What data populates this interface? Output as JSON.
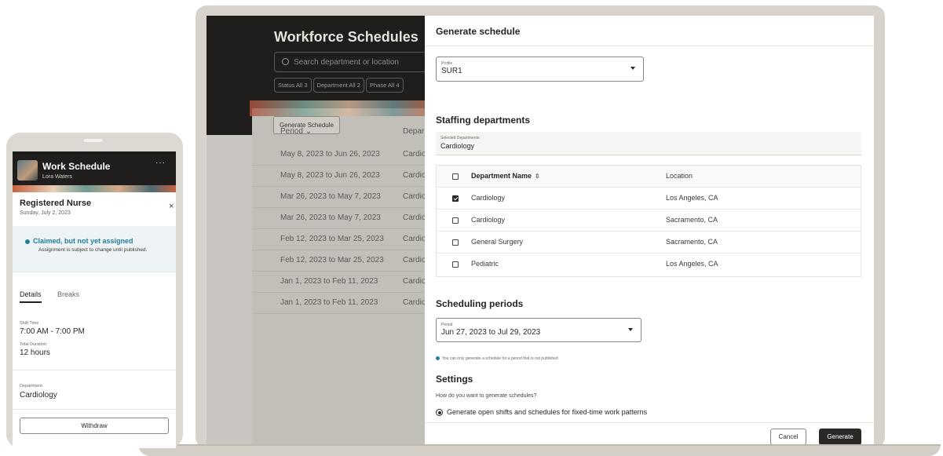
{
  "laptop": {
    "background_app": {
      "title": "Workforce Schedules",
      "search_placeholder": "Search department or location",
      "filters": [
        "Status All 3",
        "Department All 2",
        "Phase All 4"
      ],
      "generate_button": "Generate Schedule",
      "columns": [
        "Period",
        "Depar"
      ],
      "rows": [
        {
          "period": "May 8, 2023 to Jun 26, 2023",
          "dept": "Cardio"
        },
        {
          "period": "May 8, 2023 to Jun 26, 2023",
          "dept": "Cardio"
        },
        {
          "period": "Mar 26, 2023 to May 7, 2023",
          "dept": "Cardio"
        },
        {
          "period": "Mar 26, 2023 to May 7, 2023",
          "dept": "Cardio"
        },
        {
          "period": "Feb 12, 2023 to Mar 25, 2023",
          "dept": "Cardio"
        },
        {
          "period": "Feb 12, 2023 to Mar 25, 2023",
          "dept": "Cardio"
        },
        {
          "period": "Jan 1, 2023 to Feb 11, 2023",
          "dept": "Cardio"
        },
        {
          "period": "Jan 1, 2023 to Feb 11, 2023",
          "dept": "Cardio"
        }
      ]
    },
    "drawer": {
      "title": "Generate schedule",
      "profile": {
        "label": "Profile",
        "value": "SUR1"
      },
      "staffing": {
        "title": "Staffing departments",
        "selected_label": "Selected Departments",
        "selected_value": "Cardiology",
        "headers": {
          "name": "Department Name",
          "sort_icon": "sort-icon",
          "location": "Location"
        },
        "rows": [
          {
            "name": "Cardiology",
            "location": "Los Angeles, CA",
            "checked": true
          },
          {
            "name": "Cardiology",
            "location": "Sacramento, CA",
            "checked": false
          },
          {
            "name": "General Surgery",
            "location": "Sacramento, CA",
            "checked": false
          },
          {
            "name": "Pediatric",
            "location": "Los Angeles, CA",
            "checked": false
          }
        ]
      },
      "periods": {
        "title": "Scheduling periods",
        "label": "Period",
        "value": "Jun 27, 2023 to Jul 29, 2023",
        "hint": "You can only generate a schedule for a period that is not published"
      },
      "settings": {
        "title": "Settings",
        "question": "How do you want to generate schedules?",
        "option": "Generate open shifts and schedules for fixed-time work patterns"
      },
      "cancel_label": "Cancel",
      "generate_label": "Generate"
    }
  },
  "phone": {
    "app_title": "Work Schedule",
    "user": "Lora Waters",
    "menu": "···",
    "role": "Registered Nurse",
    "date": "Sunday, July 2, 2023",
    "close": "×",
    "notice_title": "Claimed, but not yet assigned",
    "notice_body": "Assignment is subject to change until published.",
    "tabs": [
      "Details",
      "Breaks"
    ],
    "shift_time_label": "Shift Time",
    "shift_time": "7:00 AM - 7:00 PM",
    "duration_label": "Total Duration",
    "duration": "12 hours",
    "department_label": "Department",
    "department": "Cardiology",
    "withdraw": "Withdraw"
  },
  "colors": {
    "accent": "#227e9e",
    "dark": "#1f1e1c",
    "primary_button": "#2b2926"
  }
}
